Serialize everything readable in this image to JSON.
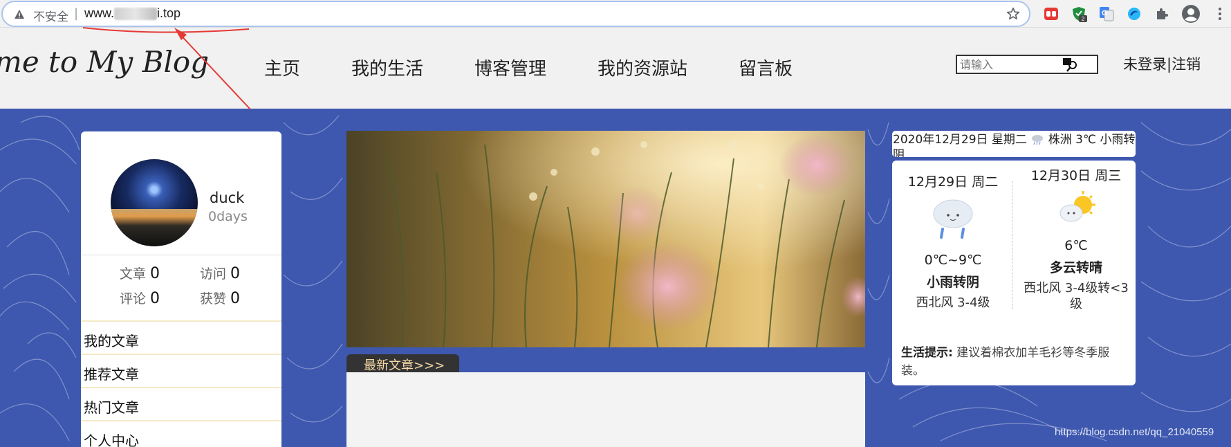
{
  "browser": {
    "security_label": "不安全",
    "separator": "|",
    "url_prefix": "www.",
    "url_suffix": "i.top",
    "extension_badge": "2"
  },
  "site": {
    "logo": "me to My Blog",
    "nav": [
      "主页",
      "我的生活",
      "博客管理",
      "我的资源站",
      "留言板"
    ],
    "search_placeholder": "请输入",
    "login": "未登录|注销"
  },
  "profile": {
    "name": "duck",
    "days": "0days",
    "stats": [
      {
        "label": "文章",
        "value": "0"
      },
      {
        "label": "访问",
        "value": "0"
      },
      {
        "label": "评论",
        "value": "0"
      },
      {
        "label": "获赞",
        "value": "0"
      }
    ],
    "menu": [
      "我的文章",
      "推荐文章",
      "热门文章",
      "个人中心"
    ]
  },
  "content": {
    "latest_tab": "最新文章>>>"
  },
  "weather": {
    "date_line": "2020年12月29日 星期二",
    "city_line": "株洲 3℃ 小雨转阴",
    "days": [
      {
        "day": "12月29日 周二",
        "temp": "0℃~9℃",
        "cond": "小雨转阴",
        "wind": "西北风 3-4级",
        "icon": "rain-cloud-icon"
      },
      {
        "day": "12月30日 周三",
        "temp": "6℃",
        "cond": "多云转晴",
        "wind": "西北风 3-4级转<3级",
        "icon": "partly-sunny-icon"
      }
    ],
    "tip_label": "生活提示:",
    "tip_text": "建议着棉衣加羊毛衫等冬季服装。"
  },
  "watermark": "https://blog.csdn.net/qq_21040559",
  "colors": {
    "page_bg": "#3e58b0",
    "header_bg": "#f1f1f1",
    "annotation": "#e53935",
    "tab_bg": "#333333"
  }
}
